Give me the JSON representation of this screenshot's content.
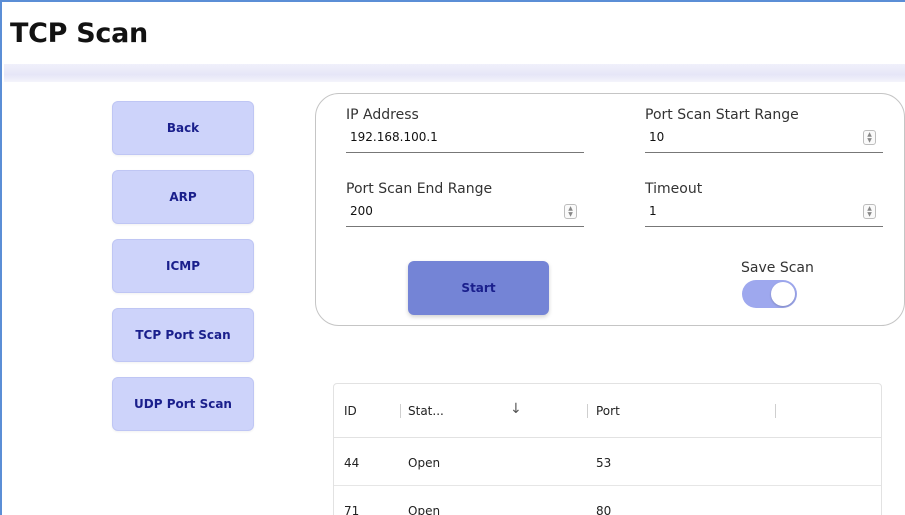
{
  "page_title": "TCP Scan",
  "nav": {
    "items": [
      {
        "label": "Back"
      },
      {
        "label": "ARP"
      },
      {
        "label": "ICMP"
      },
      {
        "label": "TCP Port Scan"
      },
      {
        "label": "UDP Port Scan"
      }
    ]
  },
  "form": {
    "ip_address": {
      "label": "IP Address",
      "value": "192.168.100.1"
    },
    "port_start": {
      "label": "Port Scan Start Range",
      "value": "10"
    },
    "port_end": {
      "label": "Port Scan End Range",
      "value": "200"
    },
    "timeout": {
      "label": "Timeout",
      "value": "1"
    },
    "start_label": "Start",
    "save_scan": {
      "label": "Save Scan",
      "enabled": true
    }
  },
  "table": {
    "columns": [
      "ID",
      "Stat...",
      "Port"
    ],
    "sort_icon": "arrow-down-icon",
    "rows": [
      {
        "id": "44",
        "status": "Open",
        "port": "53"
      },
      {
        "id": "71",
        "status": "Open",
        "port": "80"
      }
    ]
  },
  "colors": {
    "nav_button": "#cdd3fa",
    "start_button": "#7484d6",
    "toggle_on": "#9ea8ee",
    "accent_text": "#1a1f8c"
  }
}
